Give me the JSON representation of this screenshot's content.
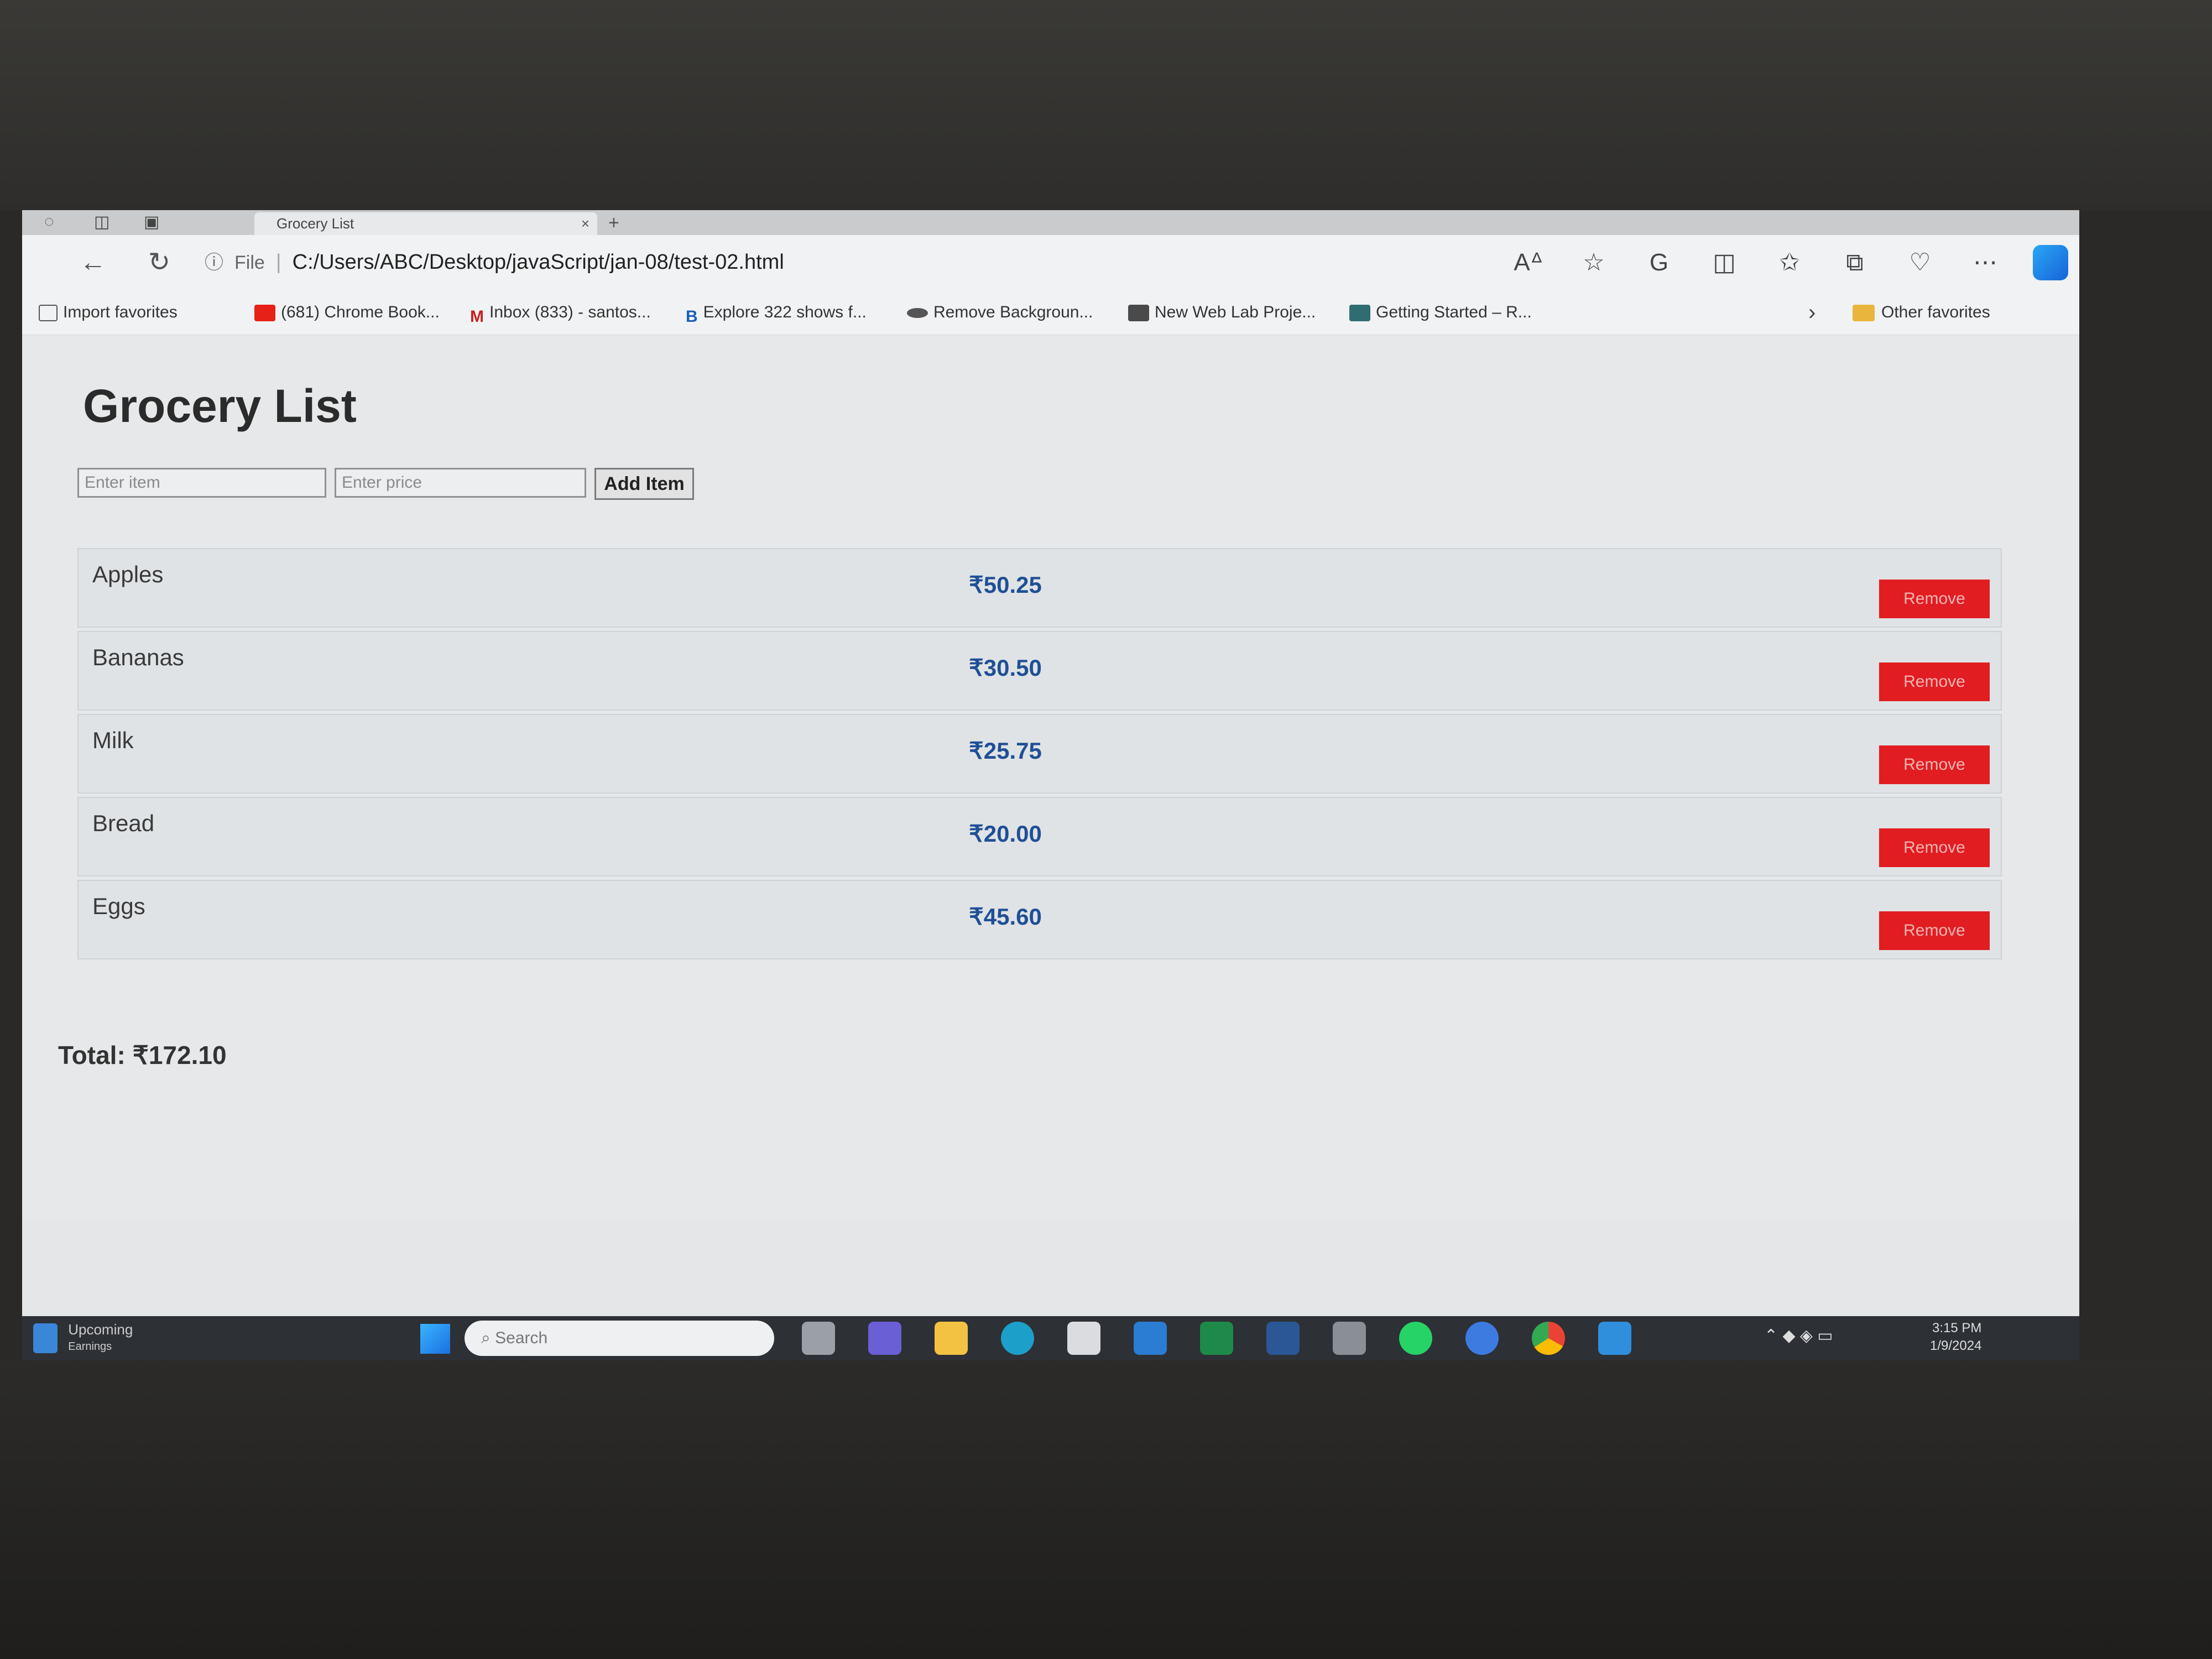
{
  "browser": {
    "tab_title": "Grocery List",
    "address": "C:/Users/ABC/Desktop/javaScript/jan-08/test-02.html",
    "file_label": "File",
    "favorites": [
      {
        "label": "Import favorites",
        "icon": "import-icon"
      },
      {
        "label": "(681) Chrome Book...",
        "icon": "youtube-icon"
      },
      {
        "label": "Inbox (833) - santos...",
        "icon": "gmail-icon"
      },
      {
        "label": "Explore 322 shows f...",
        "icon": "bookmark-icon"
      },
      {
        "label": "Remove Backgroun...",
        "icon": "remove-bg-icon"
      },
      {
        "label": "New Web Lab Proje...",
        "icon": "lab-icon"
      },
      {
        "label": "Getting Started – R...",
        "icon": "doc-icon"
      }
    ],
    "other_favorites": "Other favorites"
  },
  "page": {
    "title": "Grocery List",
    "item_placeholder": "Enter item",
    "price_placeholder": "Enter price",
    "add_button": "Add Item",
    "items": [
      {
        "name": "Apples",
        "price": "₹50.25",
        "remove": "Remove"
      },
      {
        "name": "Bananas",
        "price": "₹30.50",
        "remove": "Remove"
      },
      {
        "name": "Milk",
        "price": "₹25.75",
        "remove": "Remove"
      },
      {
        "name": "Bread",
        "price": "₹20.00",
        "remove": "Remove"
      },
      {
        "name": "Eggs",
        "price": "₹45.60",
        "remove": "Remove"
      }
    ],
    "total": "Total: ₹172.10"
  },
  "taskbar": {
    "widget_label": "Upcoming",
    "widget_sub": "Earnings",
    "search_placeholder": "Search",
    "time": "3:15 PM",
    "date": "1/9/2024"
  },
  "colors": {
    "remove_button": "#e11d21",
    "price_text": "#1f4f96"
  }
}
